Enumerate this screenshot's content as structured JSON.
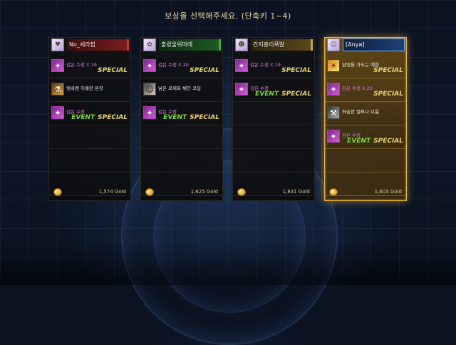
{
  "title": "보상을 선택해주세요. (단축키 1~4)",
  "panels": [
    {
      "name": "No_세라핌",
      "header_style": "red",
      "avatar": "♥",
      "slots": [
        {
          "icon": "crystal-icon",
          "glyph": "✦",
          "name": "검은 수정 X 19",
          "name_style": "purple",
          "event": "",
          "special": "SPECIAL"
        },
        {
          "icon": "potion-icon",
          "glyph": "⚗",
          "name": "빛바랜 이월란 완장",
          "name_style": "normal",
          "event": "",
          "special": ""
        },
        {
          "icon": "crystal-icon",
          "glyph": "✦",
          "name": "검은 수정",
          "name_style": "purple",
          "event": "EVENT",
          "special": "SPECIAL"
        }
      ],
      "gold": "1,574 Gold"
    },
    {
      "name": "출렁울위마레",
      "header_style": "green",
      "avatar": "✿",
      "slots": [
        {
          "icon": "crystal-icon",
          "glyph": "✦",
          "name": "검은 수정 X 20",
          "name_style": "purple",
          "event": "",
          "special": "SPECIAL"
        },
        {
          "icon": "character-icon",
          "glyph": "☺",
          "name": "낡은 로제프 체인 코일",
          "name_style": "normal",
          "event": "",
          "special": ""
        },
        {
          "icon": "crystal-icon",
          "glyph": "✦",
          "name": "검은 수정",
          "name_style": "purple",
          "event": "EVENT",
          "special": "SPECIAL"
        }
      ],
      "gold": "1,625 Gold"
    },
    {
      "name": "간지흥리폭발",
      "header_style": "gold",
      "avatar": "☻",
      "slots": [
        {
          "icon": "crystal-icon",
          "glyph": "✦",
          "name": "검은 수정 X 19",
          "name_style": "purple",
          "event": "",
          "special": "SPECIAL"
        },
        {
          "icon": "crystal-icon",
          "glyph": "✦",
          "name": "검은 수정",
          "name_style": "purple",
          "event": "EVENT",
          "special": "SPECIAL"
        }
      ],
      "gold": "1,831 Gold"
    },
    {
      "name": "[Anya]",
      "header_style": "blue",
      "avatar": "☺",
      "selected": true,
      "slots": [
        {
          "icon": "pot-icon",
          "glyph": "☀",
          "name": "달빛을 가두는 예향",
          "name_style": "normal",
          "event": "",
          "special": "SPECIAL"
        },
        {
          "icon": "crystal-icon",
          "glyph": "✦",
          "name": "검은 수정 X 20",
          "name_style": "purple",
          "event": "",
          "special": "SPECIAL"
        },
        {
          "icon": "broom-icon",
          "glyph": "⚒",
          "name": "허술한 엘루나 브룸",
          "name_style": "normal",
          "event": "",
          "special": ""
        },
        {
          "icon": "crystal-icon",
          "glyph": "✦",
          "name": "검은 수정",
          "name_style": "purple",
          "event": "EVENT",
          "special": "SPECIAL"
        }
      ],
      "gold": "1,603 Gold"
    }
  ]
}
